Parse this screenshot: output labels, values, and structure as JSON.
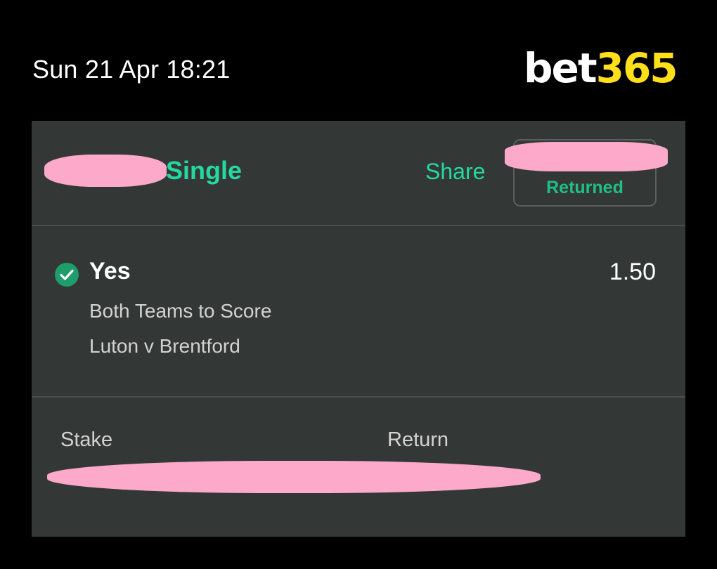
{
  "status_bar": {
    "datetime": "Sun 21 Apr 18:21"
  },
  "brand": {
    "logo_part1": "bet",
    "logo_part2": "365"
  },
  "bet_card": {
    "bet_type": "Single",
    "share_label": "Share",
    "status_label": "Returned",
    "selection": {
      "name": "Yes",
      "odds": "1.50",
      "market": "Both Teams to Score",
      "event": "Luton v Brentford",
      "result_icon": "check-circle-icon"
    },
    "footer": {
      "stake_label": "Stake",
      "return_label": "Return"
    }
  },
  "colors": {
    "background": "#000000",
    "card": "#333836",
    "accent_green": "#26d7a0",
    "logo_yellow": "#ffdf1b",
    "check_green": "#1d9e6c",
    "redaction_pink": "#fdaaca"
  }
}
